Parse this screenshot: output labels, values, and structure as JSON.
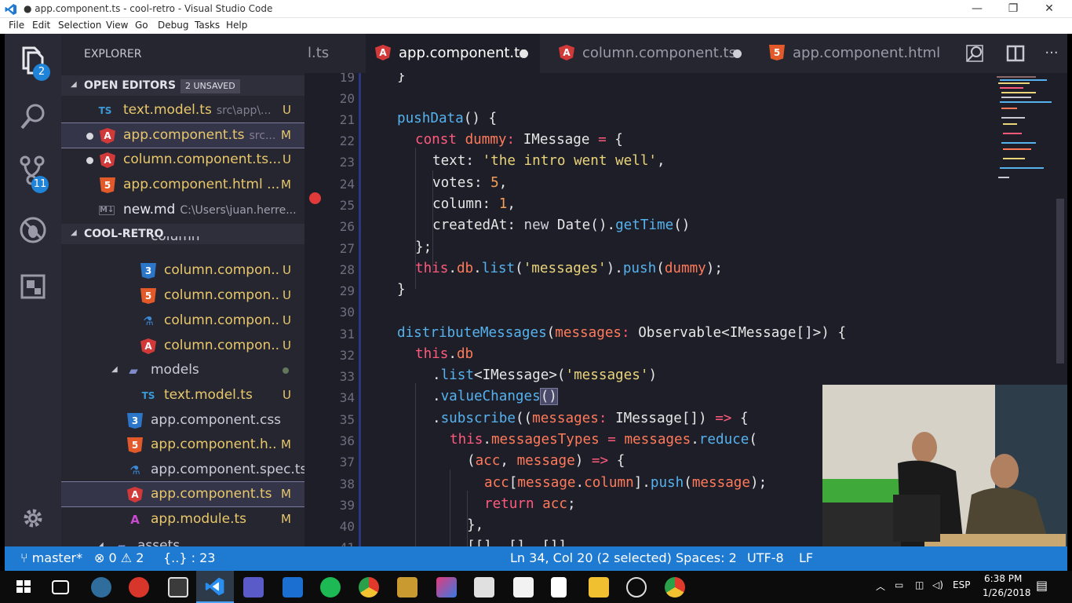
{
  "window": {
    "title": "● app.component.ts - cool-retro - Visual Studio Code",
    "controls": {
      "minimize": "—",
      "maximize": "❐",
      "close": "✕"
    }
  },
  "menu": [
    "File",
    "Edit",
    "Selection",
    "View",
    "Go",
    "Debug",
    "Tasks",
    "Help"
  ],
  "activity_bar": {
    "explorer_badge": "2",
    "scm_badge": "11",
    "icons": [
      "files-icon",
      "search-icon",
      "source-control-icon",
      "debug-icon",
      "extensions-icon",
      "gear-icon"
    ]
  },
  "sidebar": {
    "title": "EXPLORER",
    "open_editors": {
      "label": "OPEN EDITORS",
      "unsaved_badge": "2 UNSAVED",
      "items": [
        {
          "icon": "TS",
          "name": "text.model.ts",
          "path": "src\\app\\...",
          "status": "U"
        },
        {
          "icon": "A",
          "name": "app.component.ts",
          "path": "src...",
          "status": "M"
        },
        {
          "icon": "A",
          "name": "column.component.ts...",
          "path": "",
          "status": "U"
        },
        {
          "icon": "5",
          "name": "app.component.html ...",
          "path": "",
          "status": "M"
        },
        {
          "icon": "M↓",
          "name": "new.md",
          "path": "C:\\Users\\juan.herre...",
          "status": ""
        }
      ]
    },
    "project": {
      "label": "COOL-RETRO",
      "partial_folder": "column",
      "items": [
        {
          "icon": "3",
          "name": "column.compon..",
          "status": "U"
        },
        {
          "icon": "5",
          "name": "column.compon..",
          "status": "U"
        },
        {
          "icon": "spec",
          "name": "column.compon..",
          "status": "U"
        },
        {
          "icon": "A",
          "name": "column.compon..",
          "status": "U"
        },
        {
          "icon": "folder",
          "name": "models",
          "status": ""
        },
        {
          "icon": "TS",
          "name": "text.model.ts",
          "status": "U"
        },
        {
          "icon": "3",
          "name": "app.component.css",
          "status": ""
        },
        {
          "icon": "5",
          "name": "app.component.h..",
          "status": "M"
        },
        {
          "icon": "spec",
          "name": "app.component.spec.ts",
          "status": ""
        },
        {
          "icon": "A",
          "name": "app.component.ts",
          "status": "M"
        },
        {
          "icon": "A",
          "name": "app.module.ts",
          "status": "M"
        },
        {
          "icon": "folder",
          "name": "assets",
          "status": ""
        }
      ]
    }
  },
  "tabs": [
    {
      "label": "l.ts",
      "icon": "",
      "dirty": false,
      "active": false
    },
    {
      "label": "app.component.ts",
      "icon": "A",
      "dirty": true,
      "active": true
    },
    {
      "label": "column.component.ts",
      "icon": "A",
      "dirty": true,
      "active": false
    },
    {
      "label": "app.component.html",
      "icon": "5",
      "dirty": false,
      "active": false
    }
  ],
  "editor": {
    "line_numbers": [
      "19",
      "20",
      "21",
      "22",
      "23",
      "24",
      "25",
      "26",
      "27",
      "28",
      "29",
      "30",
      "31",
      "32",
      "33",
      "34",
      "35",
      "36",
      "37",
      "38",
      "39",
      "40",
      "41"
    ],
    "breakpoint_line": "23"
  },
  "statusbar": {
    "branch": "master*",
    "errors": "0",
    "warnings": "2",
    "braces": "{..} : 23",
    "position": "Ln 34, Col 20 (2 selected)",
    "spaces": "Spaces: 2",
    "encoding": "UTF-8",
    "eol": "LF"
  },
  "taskbar": {
    "time": "6:38 PM",
    "date": "1/26/2018",
    "lang": "ESP"
  }
}
